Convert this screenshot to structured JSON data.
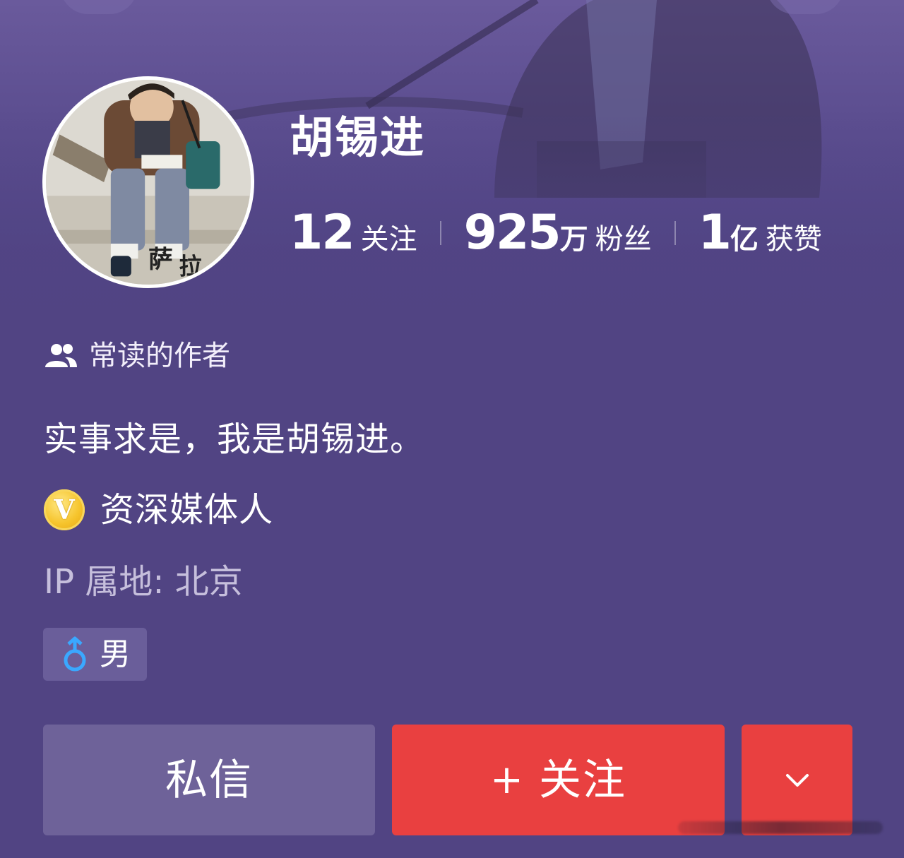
{
  "profile": {
    "name": "胡锡进",
    "bio": "实事求是，我是胡锡进。",
    "verification": "资深媒体人",
    "verification_badge": "V",
    "ip_location": "IP 属地: 北京",
    "gender": "男",
    "frequent_tag": "常读的作者"
  },
  "stats": {
    "following_count": "12",
    "following_label": "关注",
    "fans_count": "925",
    "fans_unit": "万",
    "fans_label": "粉丝",
    "likes_count": "1",
    "likes_unit": "亿",
    "likes_label": "获赞"
  },
  "actions": {
    "message_label": "私信",
    "follow_plus": "+",
    "follow_label": "关注"
  },
  "colors": {
    "background": "#514483",
    "follow_button": "#e94040",
    "message_button": "#6e6299",
    "gender_icon": "#3aa8ff",
    "badge_gold": "#f6c42c"
  },
  "icons": {
    "frequent": "users-icon",
    "verification": "v-badge-icon",
    "gender": "male-symbol-icon",
    "more": "chevron-down-icon"
  }
}
